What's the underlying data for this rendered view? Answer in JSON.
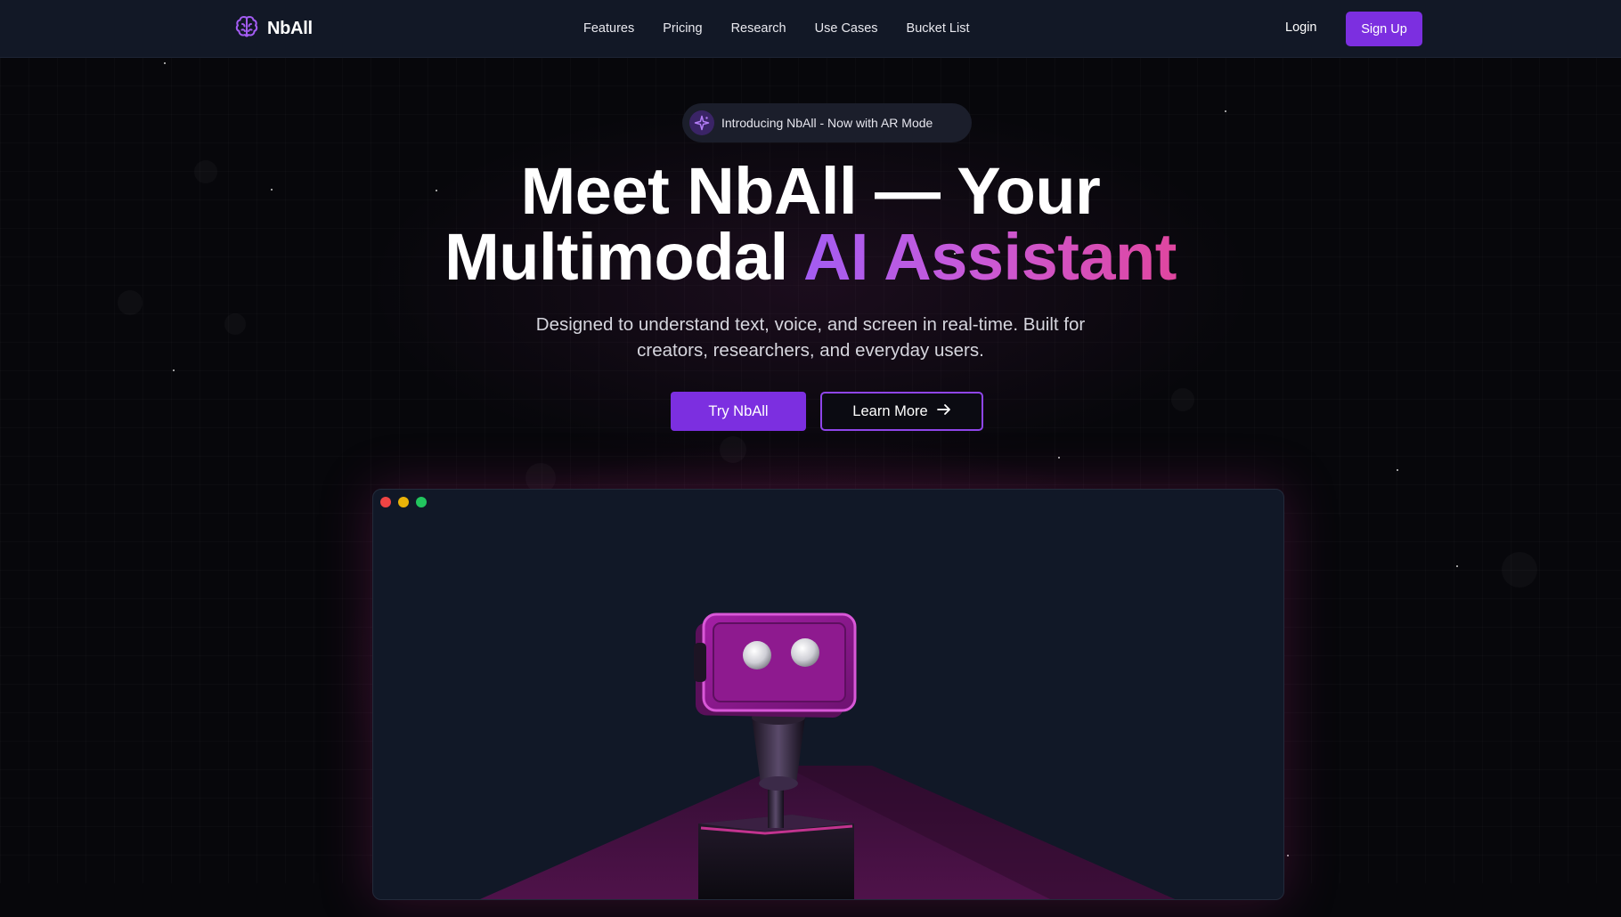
{
  "brand": {
    "name": "NbAll",
    "icon": "brain-icon",
    "accent_color": "#7c2fe0"
  },
  "nav": {
    "links": [
      "Features",
      "Pricing",
      "Research",
      "Use Cases",
      "Bucket List"
    ],
    "login_label": "Login",
    "signup_label": "Sign Up"
  },
  "hero": {
    "badge_icon": "sparkle-icon",
    "badge_text": "Introducing NbAll - Now with AR Mode",
    "headline_line1": "Meet NbAll — Your",
    "headline_line2_plain": "Multimodal ",
    "headline_line2_gradient": "AI Assistant",
    "subtitle": "Designed to understand text, voice, and screen in real-time. Built for creators, researchers, and everyday users.",
    "primary_button": "Try NbAll",
    "secondary_button": "Learn More",
    "secondary_button_icon": "arrow-right-icon"
  },
  "preview": {
    "window_controls": [
      "close",
      "minimize",
      "maximize"
    ],
    "illustration": "robot-illustration",
    "colors": {
      "window_bg": "#111827",
      "robot_magenta": "#8e1a8f",
      "glow_pink": "#d1309a"
    }
  }
}
